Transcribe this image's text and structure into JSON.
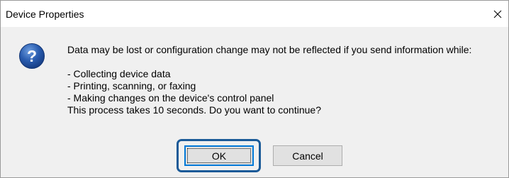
{
  "window": {
    "title": "Device Properties"
  },
  "icons": {
    "question": "question-icon",
    "close": "close-icon"
  },
  "message": {
    "intro": "Data may be lost or configuration change may not be reflected if you send information while:",
    "items": [
      "- Collecting device data",
      "- Printing, scanning, or faxing",
      "- Making changes on the device's control panel"
    ],
    "question": "This process takes 10 seconds. Do you want to continue?"
  },
  "buttons": {
    "ok_label": "OK",
    "cancel_label": "Cancel"
  },
  "colors": {
    "highlight": "#1a5a98",
    "icon_blue": "#1f4e96",
    "body_background": "#f0f0f0"
  }
}
